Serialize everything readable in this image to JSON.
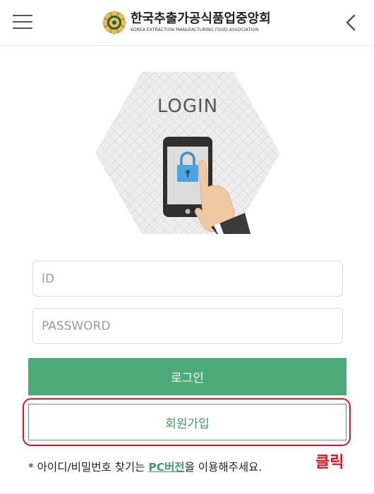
{
  "header": {
    "org_name": "한국추출가공식품업중앙회",
    "org_name_en": "KOREA EXTRACTION MANUFACTURING FOOD ASSOCIATION",
    "menu_icon": "hamburger-menu-icon",
    "back_icon": "chevron-left-icon"
  },
  "hero": {
    "title": "LOGIN",
    "icon": "phone-lock-touch-icon"
  },
  "form": {
    "id_placeholder": "ID",
    "id_value": "",
    "password_placeholder": "PASSWORD",
    "password_value": "",
    "login_label": "로그인",
    "join_label": "회원가입"
  },
  "annotation": {
    "click_label": "클릭",
    "color": "#e3121b"
  },
  "note": {
    "prefix": "* 아이디/비밀번호 찾기는 ",
    "link": "PC버전",
    "suffix": "을 이용해주세요."
  },
  "colors": {
    "accent": "#4caa78",
    "highlight": "#e3121b"
  }
}
